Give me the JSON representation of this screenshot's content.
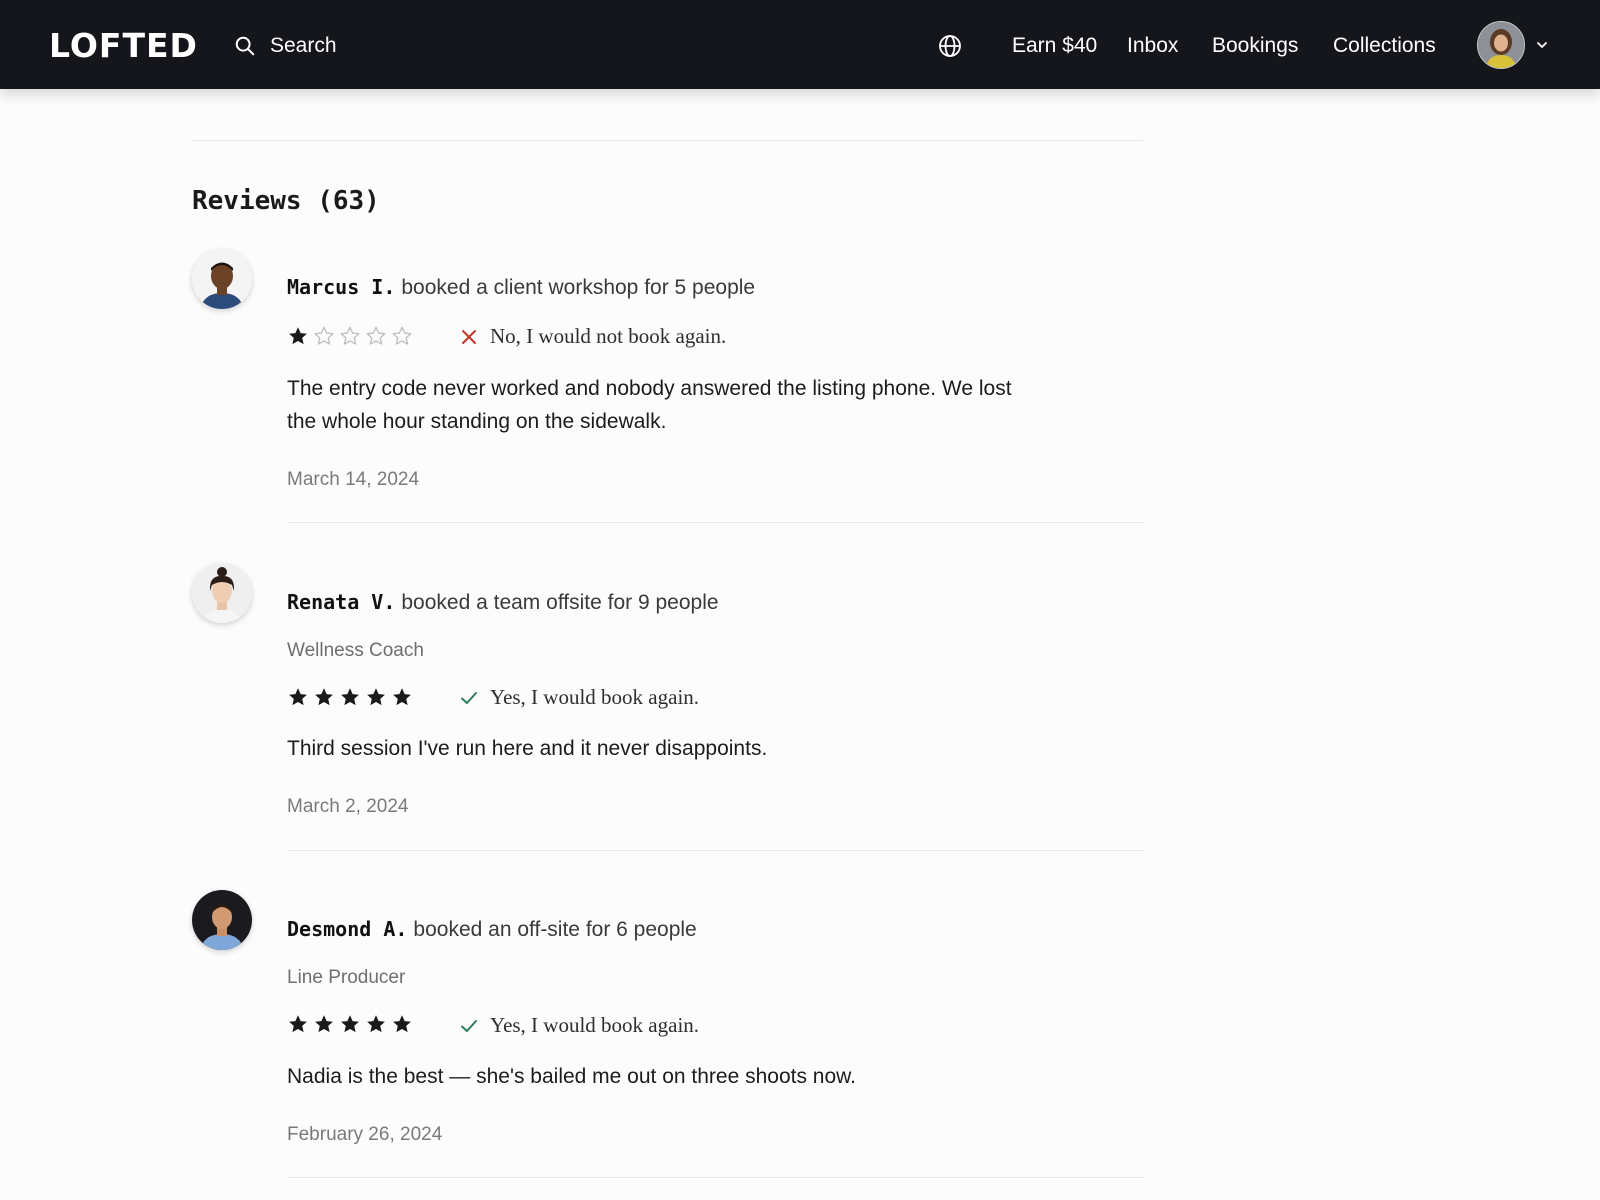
{
  "nav": {
    "logo": "LOFTED",
    "search_label": "Search",
    "links": [
      "Earn $40",
      "Inbox",
      "Bookings",
      "Collections"
    ]
  },
  "reviews_title": "Reviews (63)",
  "reviews": [
    {
      "name": "Marcus I.",
      "booked": "booked a client workshop for 5 people",
      "role": "",
      "rating": 1,
      "would_book_again": false,
      "verdict": "No, I would not book again.",
      "body": "The entry code never worked and nobody answered the listing phone. We lost the whole hour standing on the sidewalk.",
      "date": "March 14, 2024"
    },
    {
      "name": "Renata V.",
      "booked": "booked a team offsite for 9 people",
      "role": "Wellness Coach",
      "rating": 5,
      "would_book_again": true,
      "verdict": "Yes, I would book again.",
      "body": "Third session I've run here and it never disappoints.",
      "date": "March 2, 2024"
    },
    {
      "name": "Desmond A.",
      "booked": "booked an off-site for 6 people",
      "role": "Line Producer",
      "rating": 5,
      "would_book_again": true,
      "verdict": "Yes, I would book again.",
      "body": "Nadia is the best — she's bailed me out on three shoots now.",
      "date": "February 26, 2024"
    }
  ],
  "colors": {
    "nav_bg": "#14161b",
    "star": "#1a1a1a",
    "star_empty": "#bdbdbd",
    "yes": "#2f7a57",
    "no": "#c0392b"
  }
}
